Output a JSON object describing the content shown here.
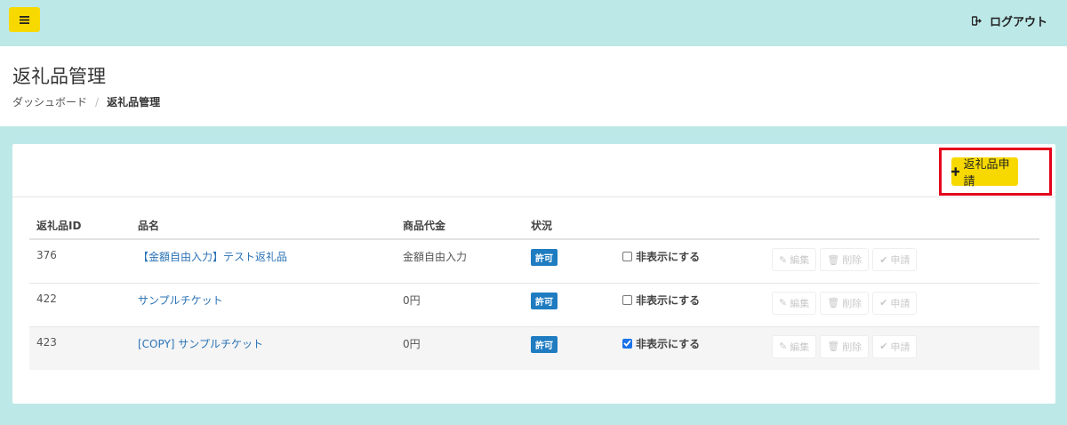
{
  "topbar": {
    "menu_icon": "hamburger-icon",
    "logout_label": "ログアウト",
    "logout_icon": "sign-out-icon"
  },
  "header": {
    "title": "返礼品管理",
    "breadcrumb": [
      "ダッシュボード",
      "返礼品管理"
    ]
  },
  "toolbar": {
    "apply_label": "返礼品申請",
    "apply_icon": "plus-icon"
  },
  "table": {
    "columns": [
      "返礼品ID",
      "品名",
      "商品代金",
      "状況"
    ],
    "rows": [
      {
        "id": "376",
        "name": "【金額自由入力】テスト返礼品",
        "price": "金額自由入力",
        "status": "許可",
        "hide_label": "非表示にする",
        "hidden": false
      },
      {
        "id": "422",
        "name": "サンプルチケット",
        "price": "0円",
        "status": "許可",
        "hide_label": "非表示にする",
        "hidden": false
      },
      {
        "id": "423",
        "name": "[COPY] サンプルチケット",
        "price": "0円",
        "status": "許可",
        "hide_label": "非表示にする",
        "hidden": true
      }
    ],
    "actions": {
      "edit": "編集",
      "delete": "削除",
      "apply": "申請"
    }
  },
  "colors": {
    "background": "#bde8e8",
    "accent_yellow": "#f7d900",
    "badge_blue": "#1f7cc1",
    "link_blue": "#2a72b5",
    "highlight_red": "#e3001c"
  }
}
